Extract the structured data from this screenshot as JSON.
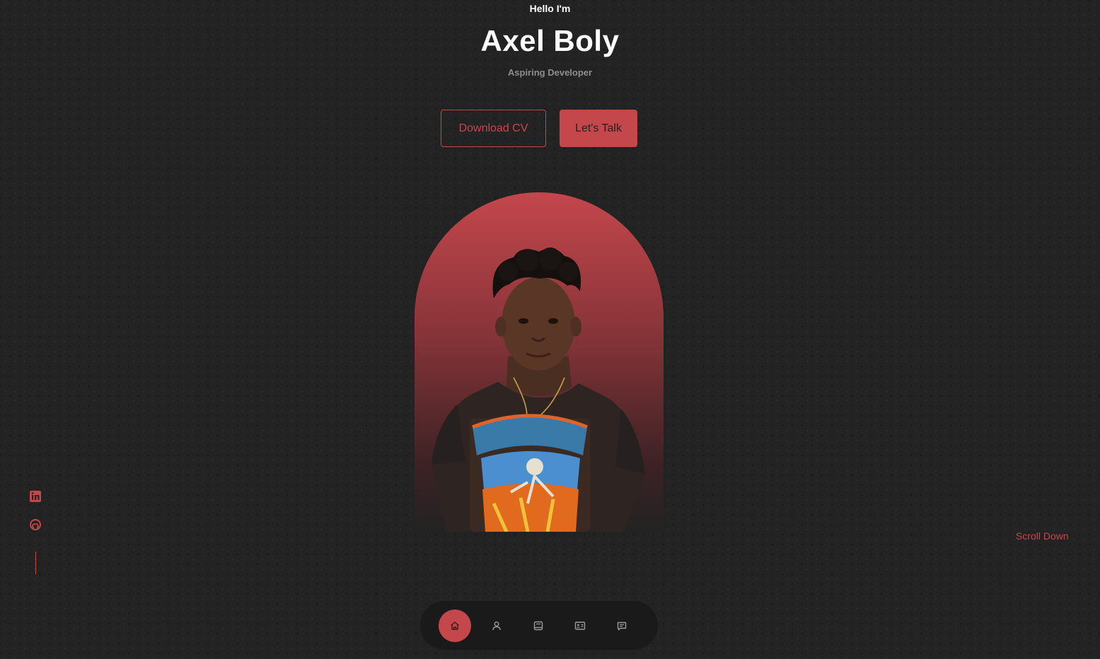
{
  "hero": {
    "greeting": "Hello I'm",
    "name": "Axel Boly",
    "role": "Aspiring Developer",
    "download_cv_label": "Download CV",
    "lets_talk_label": "Let's Talk"
  },
  "socials": [
    {
      "icon": "linkedin-icon"
    },
    {
      "icon": "github-icon"
    }
  ],
  "scroll_down_label": "Scroll Down",
  "nav": {
    "items": [
      {
        "icon": "home-icon",
        "active": true
      },
      {
        "icon": "user-icon",
        "active": false
      },
      {
        "icon": "book-icon",
        "active": false
      },
      {
        "icon": "id-card-icon",
        "active": false
      },
      {
        "icon": "message-icon",
        "active": false
      }
    ]
  },
  "colors": {
    "accent": "#c4474c",
    "background": "#232323",
    "nav_background": "#1a1a1a",
    "muted_text": "#8d8d8d"
  }
}
